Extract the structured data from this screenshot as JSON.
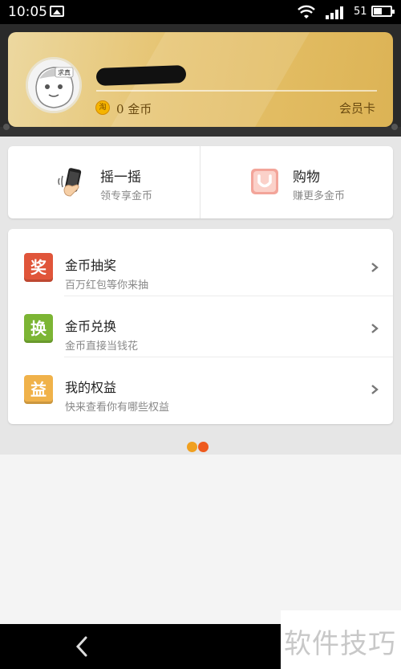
{
  "status_bar": {
    "time": "10:05",
    "battery_level": "51",
    "icons": [
      "gallery-icon",
      "wifi-icon",
      "signal-icon",
      "battery-icon"
    ]
  },
  "profile": {
    "coin_count": "0 金币",
    "coin_icon_text": "淘",
    "member_card_label": "会员卡",
    "avatar_caption": "求真"
  },
  "quick_actions": [
    {
      "title": "摇一摇",
      "subtitle": "领专享金币",
      "icon": "shake-phone-icon"
    },
    {
      "title": "购物",
      "subtitle": "赚更多金币",
      "icon": "shopping-bag-icon"
    }
  ],
  "menu": [
    {
      "badge": "奖",
      "badge_color": "#e0553a",
      "title": "金币抽奖",
      "subtitle": "百万红包等你来抽"
    },
    {
      "badge": "换",
      "badge_color": "#7cb534",
      "title": "金币兑换",
      "subtitle": "金币直接当钱花"
    },
    {
      "badge": "益",
      "badge_color": "#f0b24a",
      "title": "我的权益",
      "subtitle": "快来查看你有哪些权益"
    }
  ],
  "colors": {
    "dot_left": "#f0a020",
    "dot_right": "#ee5a1e"
  },
  "watermark": "软件技巧"
}
